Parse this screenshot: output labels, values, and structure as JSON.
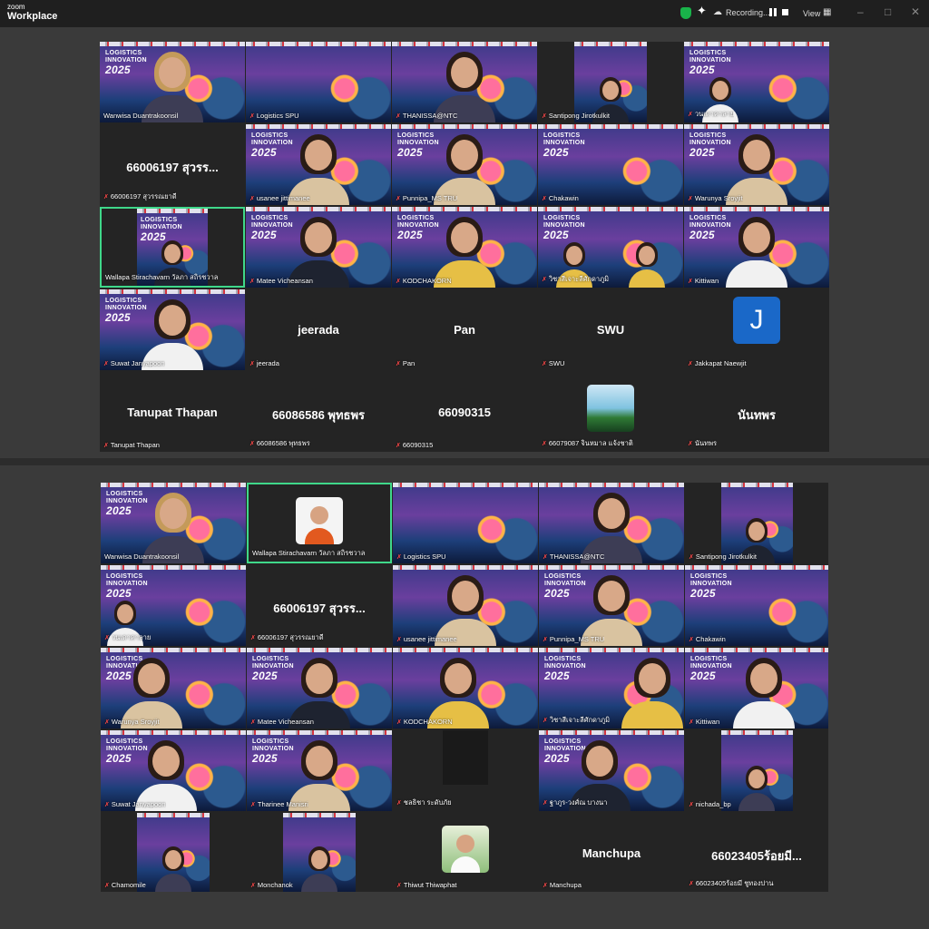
{
  "app": {
    "brand_top": "zoom",
    "brand_bottom": "Workplace"
  },
  "toolbar": {
    "recording_label": "Recording...",
    "view_label": "View"
  },
  "colors": {
    "active_speaker_border": "#3fd88a",
    "mute_icon": "#ff4a4a",
    "avatar_blue": "#1a68c8"
  },
  "icons": {
    "mute": "✗",
    "record": "☁",
    "sparkle": "✦",
    "view_grid": "▦"
  },
  "background_text": {
    "line1": "LOGISTICS",
    "line2": "INNOVATION",
    "year": "2025"
  },
  "top_grid": {
    "tiles": [
      {
        "name": "Wanwisa Duantrakoonsil"
      },
      {
        "name": "Logistics SPU"
      },
      {
        "name": "THANISSA@NTC"
      },
      {
        "name": "Santipong Jirotkulkit"
      },
      {
        "name": "วนเดาคาลาย"
      },
      {
        "name": "66006197 สุวรรณยาดี",
        "display_name": "66006197 สุวรร..."
      },
      {
        "name": "usanee jittimanee"
      },
      {
        "name": "Punnipa_MS TRU"
      },
      {
        "name": "Chakawin"
      },
      {
        "name": "Warunya Sroyjit"
      },
      {
        "name": "Wallapa Stirachavarn วัลภา สถิรชวาล"
      },
      {
        "name": "Matee Vicheansan"
      },
      {
        "name": "KODCHAKORN"
      },
      {
        "name": "วิชาสีเจาะลีศักดาภูมิ"
      },
      {
        "name": "Kittiwan"
      },
      {
        "name": "Suwat Janyapoon"
      },
      {
        "name": "jeerada",
        "display_name": "jeerada"
      },
      {
        "name": "Pan",
        "display_name": "Pan"
      },
      {
        "name": "SWU",
        "display_name": "SWU"
      },
      {
        "name": "Jakkapat Naewjit",
        "avatar_letter": "J"
      },
      {
        "name": "Tanupat Thapan",
        "display_name": "Tanupat Thapan"
      },
      {
        "name": "66086586 พุทธพร",
        "display_name": "66086586 พุทธพร"
      },
      {
        "name": "66090315",
        "display_name": "66090315"
      },
      {
        "name": "66079087 จินหมาล แจ้งชาติ"
      },
      {
        "name": "นันทพร",
        "display_name": "นันทพร"
      }
    ]
  },
  "bottom_grid": {
    "tiles": [
      {
        "name": "Wanwisa Duantrakoonsil"
      },
      {
        "name": "Wallapa Stirachavarn วัลภา สถิรชวาล"
      },
      {
        "name": "Logistics SPU"
      },
      {
        "name": "THANISSA@NTC"
      },
      {
        "name": "Santipong Jirotkulkit"
      },
      {
        "name": "วนเดาคาลาย"
      },
      {
        "name": "66006197 สุวรรณยาดี",
        "display_name": "66006197 สุวรร..."
      },
      {
        "name": "usanee jittimanee"
      },
      {
        "name": "Punnipa_MS TRU"
      },
      {
        "name": "Chakawin"
      },
      {
        "name": "Warunya Sroyjit"
      },
      {
        "name": "Matee Vicheansan"
      },
      {
        "name": "KODCHAKORN"
      },
      {
        "name": "วิชาสีเจาะลีศักดาภูมิ"
      },
      {
        "name": "Kittiwan"
      },
      {
        "name": "Suwat Janyapoon"
      },
      {
        "name": "Tharinee Manisri"
      },
      {
        "name": "ชลธิชา ระดับภัย"
      },
      {
        "name": "ฐาภูร-วงศ์ณ บางนา"
      },
      {
        "name": "nichada_bp"
      },
      {
        "name": "Chamomile"
      },
      {
        "name": "Monchanok"
      },
      {
        "name": "Thiwut Thiwaphat"
      },
      {
        "name": "Manchupa",
        "display_name": "Manchupa"
      },
      {
        "name": "66023405ร้อยมี ชูทองปาน",
        "display_name": "66023405ร้อยมี..."
      }
    ]
  }
}
